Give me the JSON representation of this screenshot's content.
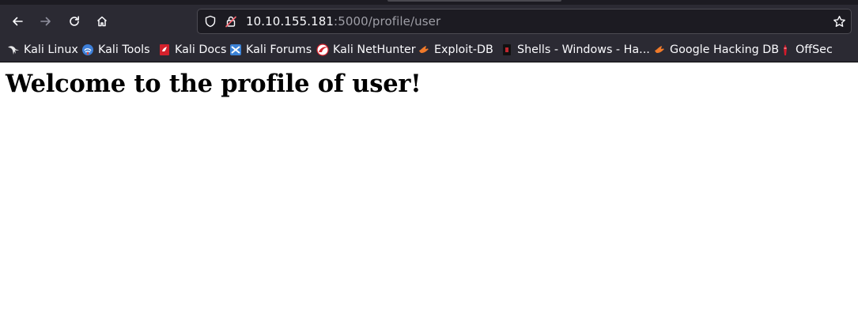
{
  "browser": {
    "url_host": "10.10.155.181",
    "url_rest": ":5000/profile/user"
  },
  "bookmarks": [
    {
      "label": "Kali Linux",
      "icon": "kali-dragon-icon"
    },
    {
      "label": "Kali Tools",
      "icon": "kali-tools-icon"
    },
    {
      "label": "Kali Docs",
      "icon": "kali-docs-icon"
    },
    {
      "label": "Kali Forums",
      "icon": "kali-forums-icon"
    },
    {
      "label": "Kali NetHunter",
      "icon": "nethunter-icon"
    },
    {
      "label": "Exploit-DB",
      "icon": "exploit-db-icon"
    },
    {
      "label": "Shells - Windows - Ha...",
      "icon": "shells-icon"
    },
    {
      "label": "Google Hacking DB",
      "icon": "ghdb-icon"
    },
    {
      "label": "OffSec",
      "icon": "offsec-icon"
    }
  ],
  "page": {
    "heading": "Welcome to the profile of user!"
  }
}
